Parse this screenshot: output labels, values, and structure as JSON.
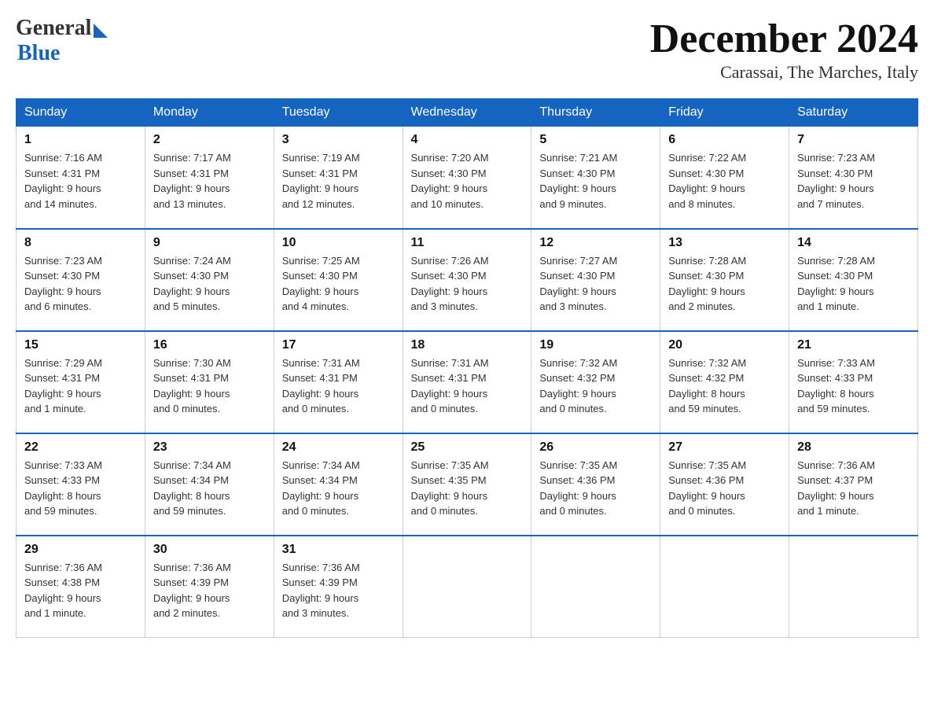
{
  "logo": {
    "general": "General",
    "blue": "Blue"
  },
  "title": "December 2024",
  "subtitle": "Carassai, The Marches, Italy",
  "days_of_week": [
    "Sunday",
    "Monday",
    "Tuesday",
    "Wednesday",
    "Thursday",
    "Friday",
    "Saturday"
  ],
  "weeks": [
    [
      {
        "num": "1",
        "sunrise": "7:16 AM",
        "sunset": "4:31 PM",
        "daylight": "9 hours and 14 minutes."
      },
      {
        "num": "2",
        "sunrise": "7:17 AM",
        "sunset": "4:31 PM",
        "daylight": "9 hours and 13 minutes."
      },
      {
        "num": "3",
        "sunrise": "7:19 AM",
        "sunset": "4:31 PM",
        "daylight": "9 hours and 12 minutes."
      },
      {
        "num": "4",
        "sunrise": "7:20 AM",
        "sunset": "4:30 PM",
        "daylight": "9 hours and 10 minutes."
      },
      {
        "num": "5",
        "sunrise": "7:21 AM",
        "sunset": "4:30 PM",
        "daylight": "9 hours and 9 minutes."
      },
      {
        "num": "6",
        "sunrise": "7:22 AM",
        "sunset": "4:30 PM",
        "daylight": "9 hours and 8 minutes."
      },
      {
        "num": "7",
        "sunrise": "7:23 AM",
        "sunset": "4:30 PM",
        "daylight": "9 hours and 7 minutes."
      }
    ],
    [
      {
        "num": "8",
        "sunrise": "7:23 AM",
        "sunset": "4:30 PM",
        "daylight": "9 hours and 6 minutes."
      },
      {
        "num": "9",
        "sunrise": "7:24 AM",
        "sunset": "4:30 PM",
        "daylight": "9 hours and 5 minutes."
      },
      {
        "num": "10",
        "sunrise": "7:25 AM",
        "sunset": "4:30 PM",
        "daylight": "9 hours and 4 minutes."
      },
      {
        "num": "11",
        "sunrise": "7:26 AM",
        "sunset": "4:30 PM",
        "daylight": "9 hours and 3 minutes."
      },
      {
        "num": "12",
        "sunrise": "7:27 AM",
        "sunset": "4:30 PM",
        "daylight": "9 hours and 3 minutes."
      },
      {
        "num": "13",
        "sunrise": "7:28 AM",
        "sunset": "4:30 PM",
        "daylight": "9 hours and 2 minutes."
      },
      {
        "num": "14",
        "sunrise": "7:28 AM",
        "sunset": "4:30 PM",
        "daylight": "9 hours and 1 minute."
      }
    ],
    [
      {
        "num": "15",
        "sunrise": "7:29 AM",
        "sunset": "4:31 PM",
        "daylight": "9 hours and 1 minute."
      },
      {
        "num": "16",
        "sunrise": "7:30 AM",
        "sunset": "4:31 PM",
        "daylight": "9 hours and 0 minutes."
      },
      {
        "num": "17",
        "sunrise": "7:31 AM",
        "sunset": "4:31 PM",
        "daylight": "9 hours and 0 minutes."
      },
      {
        "num": "18",
        "sunrise": "7:31 AM",
        "sunset": "4:31 PM",
        "daylight": "9 hours and 0 minutes."
      },
      {
        "num": "19",
        "sunrise": "7:32 AM",
        "sunset": "4:32 PM",
        "daylight": "9 hours and 0 minutes."
      },
      {
        "num": "20",
        "sunrise": "7:32 AM",
        "sunset": "4:32 PM",
        "daylight": "8 hours and 59 minutes."
      },
      {
        "num": "21",
        "sunrise": "7:33 AM",
        "sunset": "4:33 PM",
        "daylight": "8 hours and 59 minutes."
      }
    ],
    [
      {
        "num": "22",
        "sunrise": "7:33 AM",
        "sunset": "4:33 PM",
        "daylight": "8 hours and 59 minutes."
      },
      {
        "num": "23",
        "sunrise": "7:34 AM",
        "sunset": "4:34 PM",
        "daylight": "8 hours and 59 minutes."
      },
      {
        "num": "24",
        "sunrise": "7:34 AM",
        "sunset": "4:34 PM",
        "daylight": "9 hours and 0 minutes."
      },
      {
        "num": "25",
        "sunrise": "7:35 AM",
        "sunset": "4:35 PM",
        "daylight": "9 hours and 0 minutes."
      },
      {
        "num": "26",
        "sunrise": "7:35 AM",
        "sunset": "4:36 PM",
        "daylight": "9 hours and 0 minutes."
      },
      {
        "num": "27",
        "sunrise": "7:35 AM",
        "sunset": "4:36 PM",
        "daylight": "9 hours and 0 minutes."
      },
      {
        "num": "28",
        "sunrise": "7:36 AM",
        "sunset": "4:37 PM",
        "daylight": "9 hours and 1 minute."
      }
    ],
    [
      {
        "num": "29",
        "sunrise": "7:36 AM",
        "sunset": "4:38 PM",
        "daylight": "9 hours and 1 minute."
      },
      {
        "num": "30",
        "sunrise": "7:36 AM",
        "sunset": "4:39 PM",
        "daylight": "9 hours and 2 minutes."
      },
      {
        "num": "31",
        "sunrise": "7:36 AM",
        "sunset": "4:39 PM",
        "daylight": "9 hours and 3 minutes."
      },
      null,
      null,
      null,
      null
    ]
  ],
  "labels": {
    "sunrise": "Sunrise:",
    "sunset": "Sunset:",
    "daylight": "Daylight:"
  }
}
